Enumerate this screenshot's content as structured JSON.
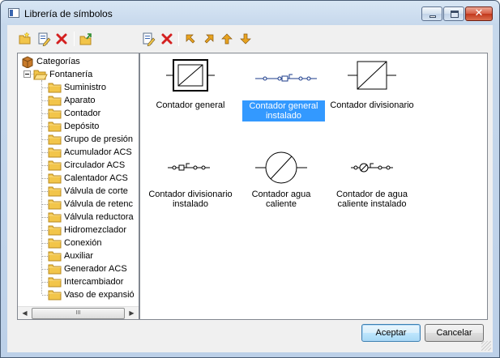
{
  "window": {
    "title": "Librería de símbolos"
  },
  "toolbar": {
    "buttons": [
      {
        "name": "new-category-button",
        "icon": "folder-new-icon"
      },
      {
        "name": "edit-category-button",
        "icon": "edit-document-icon"
      },
      {
        "name": "delete-category-button",
        "icon": "delete-x-icon"
      },
      {
        "name": "import-button",
        "icon": "folder-import-icon"
      },
      {
        "name": "edit-symbol-button",
        "icon": "edit-document-icon"
      },
      {
        "name": "delete-symbol-button",
        "icon": "delete-x-icon"
      },
      {
        "name": "move-first-button",
        "icon": "arrow-top-left-icon"
      },
      {
        "name": "move-prev-button",
        "icon": "arrow-up-right-icon"
      },
      {
        "name": "move-up-button",
        "icon": "arrow-up-icon"
      },
      {
        "name": "move-down-button",
        "icon": "arrow-down-icon"
      }
    ]
  },
  "tree": {
    "root": "Categorías",
    "group": "Fontanería",
    "items": [
      "Suministro",
      "Aparato",
      "Contador",
      "Depósito",
      "Grupo de presión",
      "Acumulador ACS",
      "Circulador ACS",
      "Calentador ACS",
      "Válvula de corte",
      "Válvula de retenc",
      "Válvula reductora",
      "Hidromezclador",
      "Conexión",
      "Auxiliar",
      "Generador ACS",
      "Intercambiador",
      "Vaso de expansió"
    ],
    "scroll_thumb_glyph": "III"
  },
  "symbols": [
    {
      "label_1": "Contador general",
      "label_2": ""
    },
    {
      "label_1": "Contador general",
      "label_2": "instalado",
      "selected": true
    },
    {
      "label_1": "Contador divisionario",
      "label_2": ""
    },
    {
      "label_1": "Contador divisionario",
      "label_2": "instalado"
    },
    {
      "label_1": "Contador agua",
      "label_2": "caliente"
    },
    {
      "label_1": "Contador de agua",
      "label_2": "caliente instalado"
    }
  ],
  "buttons": {
    "accept": "Aceptar",
    "cancel": "Cancelar"
  },
  "colors": {
    "selection": "#3399ff",
    "folder": "#f2c54a",
    "delete": "#d42020",
    "arrow": "#e8a320"
  }
}
